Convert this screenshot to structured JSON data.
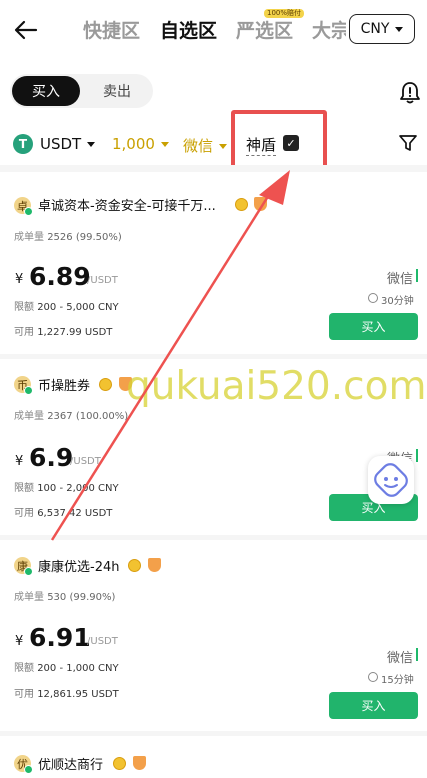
{
  "header": {
    "tabs": [
      {
        "label": "快捷区"
      },
      {
        "label": "自选区"
      },
      {
        "label": "严选区",
        "badge": "100%赔付"
      },
      {
        "label": "大宗"
      }
    ],
    "currency": "CNY"
  },
  "trade_toggle": {
    "buy": "买入",
    "sell": "卖出"
  },
  "filters": {
    "coin": "USDT",
    "coin_icon_glyph": "T",
    "amount": "1,000",
    "payment": "微信",
    "shield_label": "神盾",
    "shield_checked": true
  },
  "watermark": "qukuai520.com",
  "colors": {
    "buy_green": "#21b46c",
    "highlight_red": "#e8504f",
    "accent_gold": "#c9a000"
  },
  "merchants": [
    {
      "avatar": "卓",
      "name": "卓诚资本-资金安全-可接千万...",
      "stat_label": "成单量",
      "stat_value": "2526 (99.50%)",
      "currency_symbol": "¥",
      "price": "6.89",
      "unit": "/USDT",
      "limit_label": "限额",
      "limit_value": "200 - 5,000 CNY",
      "available_label": "可用",
      "available_value": "1,227.99 USDT",
      "payment": "微信",
      "time": "30分钟",
      "button": "买入"
    },
    {
      "avatar": "币",
      "name": "币操胜券",
      "stat_label": "成单量",
      "stat_value": "2367 (100.00%)",
      "currency_symbol": "¥",
      "price": "6.9",
      "unit": "/USDT",
      "limit_label": "限额",
      "limit_value": "100 - 2,000 CNY",
      "available_label": "可用",
      "available_value": "6,537.42 USDT",
      "payment": "微信",
      "button": "买入"
    },
    {
      "avatar": "康",
      "name": "康康优选-24h",
      "stat_label": "成单量",
      "stat_value": "530 (99.90%)",
      "currency_symbol": "¥",
      "price": "6.91",
      "unit": "/USDT",
      "limit_label": "限额",
      "limit_value": "200 - 1,000 CNY",
      "available_label": "可用",
      "available_value": "12,861.95 USDT",
      "payment": "微信",
      "time": "15分钟",
      "button": "买入"
    },
    {
      "avatar": "优",
      "name": "优顺达商行"
    }
  ]
}
